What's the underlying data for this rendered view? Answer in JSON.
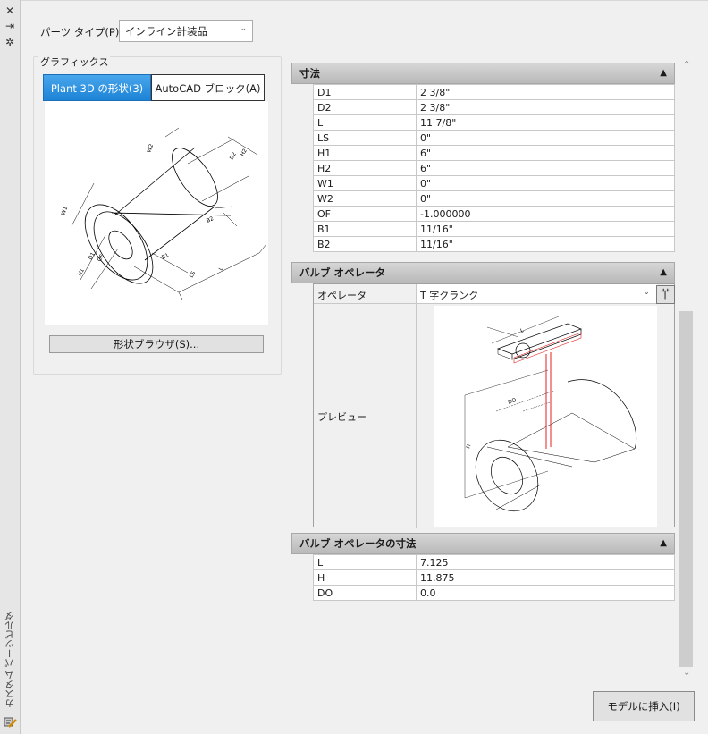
{
  "window": {
    "vertical_title": "カスタム パーツビルダ"
  },
  "part_type": {
    "label": "パーツ タイプ(P):",
    "value": "インライン計装品"
  },
  "graphics": {
    "title": "グラフィックス",
    "tabs": [
      {
        "label": "Plant 3D の形状(3)",
        "active": true
      },
      {
        "label": "AutoCAD ブロック(A)",
        "active": false
      }
    ],
    "browse_button": "形状ブラウザ(S)...",
    "drawing_labels": [
      "D1",
      "D2",
      "H1",
      "H2",
      "W1",
      "W2",
      "OF",
      "B1",
      "B2",
      "LS",
      "L"
    ]
  },
  "sections": {
    "dimensions": {
      "title": "寸法",
      "rows": [
        {
          "key": "D1",
          "value": "2 3/8\""
        },
        {
          "key": "D2",
          "value": "2 3/8\""
        },
        {
          "key": "L",
          "value": "11 7/8\""
        },
        {
          "key": "LS",
          "value": "0\""
        },
        {
          "key": "H1",
          "value": "6\""
        },
        {
          "key": "H2",
          "value": "6\""
        },
        {
          "key": "W1",
          "value": "0\""
        },
        {
          "key": "W2",
          "value": "0\""
        },
        {
          "key": "OF",
          "value": "-1.000000"
        },
        {
          "key": "B1",
          "value": "11/16\""
        },
        {
          "key": "B2",
          "value": "11/16\""
        }
      ]
    },
    "valve_operator": {
      "title": "バルブ オペレータ",
      "operator_label": "オペレータ",
      "operator_value": "T 字クランク",
      "preview_label": "プレビュー",
      "drawing_labels": [
        "L",
        "DO",
        "H"
      ]
    },
    "operator_dimensions": {
      "title": "バルブ オペレータの寸法",
      "rows": [
        {
          "key": "L",
          "value": "7.125"
        },
        {
          "key": "H",
          "value": "11.875"
        },
        {
          "key": "DO",
          "value": "0.0"
        }
      ]
    }
  },
  "insert_button": "モデルに挿入(I)",
  "colors": {
    "active_tab": "#2b8fe0",
    "operator_highlight": "#e02020"
  }
}
